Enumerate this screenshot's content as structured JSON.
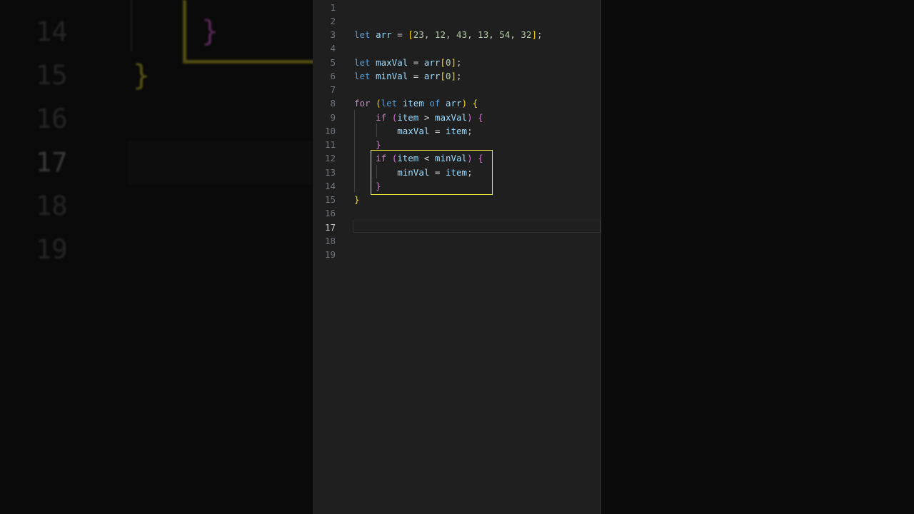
{
  "background": {
    "line_numbers": [
      {
        "n": "14"
      },
      {
        "n": "15"
      },
      {
        "n": "16"
      },
      {
        "n": "17"
      },
      {
        "n": "18"
      },
      {
        "n": "19"
      }
    ],
    "inner_brace": "}",
    "outer_brace": "}"
  },
  "editor": {
    "active_line": 17,
    "highlight_color": "#f2ea3b",
    "lines": [
      {
        "n": "1",
        "tokens": []
      },
      {
        "n": "2",
        "tokens": []
      },
      {
        "n": "3",
        "tokens": [
          {
            "t": "let",
            "c": "kw"
          },
          {
            "t": " "
          },
          {
            "t": "arr",
            "c": "var"
          },
          {
            "t": " = ",
            "c": "op"
          },
          {
            "t": "[",
            "c": "b1"
          },
          {
            "t": "23",
            "c": "num"
          },
          {
            "t": ", "
          },
          {
            "t": "12",
            "c": "num"
          },
          {
            "t": ", "
          },
          {
            "t": "43",
            "c": "num"
          },
          {
            "t": ", "
          },
          {
            "t": "13",
            "c": "num"
          },
          {
            "t": ", "
          },
          {
            "t": "54",
            "c": "num"
          },
          {
            "t": ", "
          },
          {
            "t": "32",
            "c": "num"
          },
          {
            "t": "]",
            "c": "b1"
          },
          {
            "t": ";"
          }
        ]
      },
      {
        "n": "4",
        "tokens": []
      },
      {
        "n": "5",
        "tokens": [
          {
            "t": "let",
            "c": "kw"
          },
          {
            "t": " "
          },
          {
            "t": "maxVal",
            "c": "var"
          },
          {
            "t": " = ",
            "c": "op"
          },
          {
            "t": "arr",
            "c": "var"
          },
          {
            "t": "[",
            "c": "b1"
          },
          {
            "t": "0",
            "c": "num"
          },
          {
            "t": "]",
            "c": "b1"
          },
          {
            "t": ";"
          }
        ]
      },
      {
        "n": "6",
        "tokens": [
          {
            "t": "let",
            "c": "kw"
          },
          {
            "t": " "
          },
          {
            "t": "minVal",
            "c": "var"
          },
          {
            "t": " = ",
            "c": "op"
          },
          {
            "t": "arr",
            "c": "var"
          },
          {
            "t": "[",
            "c": "b1"
          },
          {
            "t": "0",
            "c": "num"
          },
          {
            "t": "]",
            "c": "b1"
          },
          {
            "t": ";"
          }
        ]
      },
      {
        "n": "7",
        "tokens": []
      },
      {
        "n": "8",
        "tokens": [
          {
            "t": "for",
            "c": "ctl"
          },
          {
            "t": " "
          },
          {
            "t": "(",
            "c": "b1"
          },
          {
            "t": "let",
            "c": "kw"
          },
          {
            "t": " "
          },
          {
            "t": "item",
            "c": "var"
          },
          {
            "t": " "
          },
          {
            "t": "of",
            "c": "kw"
          },
          {
            "t": " "
          },
          {
            "t": "arr",
            "c": "var"
          },
          {
            "t": ")",
            "c": "b1"
          },
          {
            "t": " "
          },
          {
            "t": "{",
            "c": "b1"
          }
        ]
      },
      {
        "n": "9",
        "tokens": [
          {
            "t": "    "
          },
          {
            "t": "if",
            "c": "ctl"
          },
          {
            "t": " "
          },
          {
            "t": "(",
            "c": "b2"
          },
          {
            "t": "item",
            "c": "var"
          },
          {
            "t": " > ",
            "c": "op"
          },
          {
            "t": "maxVal",
            "c": "var"
          },
          {
            "t": ")",
            "c": "b2"
          },
          {
            "t": " "
          },
          {
            "t": "{",
            "c": "b2"
          }
        ]
      },
      {
        "n": "10",
        "tokens": [
          {
            "t": "        "
          },
          {
            "t": "maxVal",
            "c": "var"
          },
          {
            "t": " = ",
            "c": "op"
          },
          {
            "t": "item",
            "c": "var"
          },
          {
            "t": ";"
          }
        ]
      },
      {
        "n": "11",
        "tokens": [
          {
            "t": "    "
          },
          {
            "t": "}",
            "c": "b2"
          }
        ]
      },
      {
        "n": "12",
        "tokens": [
          {
            "t": "    "
          },
          {
            "t": "if",
            "c": "ctl"
          },
          {
            "t": " "
          },
          {
            "t": "(",
            "c": "b2"
          },
          {
            "t": "item",
            "c": "var"
          },
          {
            "t": " < ",
            "c": "op"
          },
          {
            "t": "minVal",
            "c": "var"
          },
          {
            "t": ")",
            "c": "b2"
          },
          {
            "t": " "
          },
          {
            "t": "{",
            "c": "b2"
          }
        ]
      },
      {
        "n": "13",
        "tokens": [
          {
            "t": "        "
          },
          {
            "t": "minVal",
            "c": "var"
          },
          {
            "t": " = ",
            "c": "op"
          },
          {
            "t": "item",
            "c": "var"
          },
          {
            "t": ";"
          }
        ]
      },
      {
        "n": "14",
        "tokens": [
          {
            "t": "    "
          },
          {
            "t": "}",
            "c": "b2"
          }
        ]
      },
      {
        "n": "15",
        "tokens": [
          {
            "t": "}",
            "c": "b1"
          }
        ]
      },
      {
        "n": "16",
        "tokens": []
      },
      {
        "n": "17",
        "tokens": []
      },
      {
        "n": "18",
        "tokens": []
      },
      {
        "n": "19",
        "tokens": []
      }
    ]
  }
}
